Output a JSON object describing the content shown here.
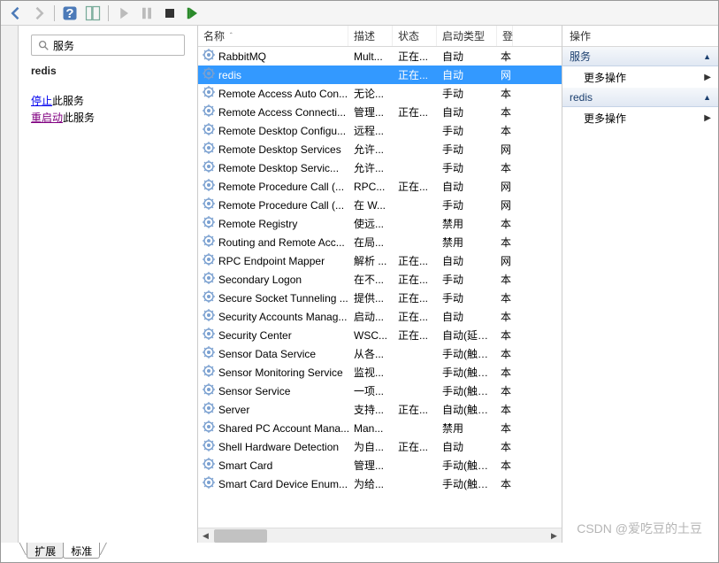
{
  "toolbar": {
    "back_icon": "back-icon",
    "forward_icon": "forward-icon",
    "help_icon": "help-icon",
    "details_icon": "details-icon",
    "play_icon": "play-icon",
    "pause_icon": "pause-icon",
    "stop_icon": "stop-icon",
    "restart_icon": "restart-icon"
  },
  "left": {
    "search_label": "服务",
    "selected_name": "redis",
    "stop_link": "停止",
    "stop_text": "此服务",
    "restart_link": "重启动",
    "restart_text": "此服务"
  },
  "grid": {
    "headers": {
      "name": "名称",
      "desc": "描述",
      "status": "状态",
      "start": "启动类型",
      "login": "登"
    },
    "rows": [
      {
        "name": "RabbitMQ",
        "desc": "Mult...",
        "status": "正在...",
        "start": "自动",
        "login": "本",
        "selected": false
      },
      {
        "name": "redis",
        "desc": "",
        "status": "正在...",
        "start": "自动",
        "login": "网",
        "selected": true
      },
      {
        "name": "Remote Access Auto Con...",
        "desc": "无论...",
        "status": "",
        "start": "手动",
        "login": "本",
        "selected": false
      },
      {
        "name": "Remote Access Connecti...",
        "desc": "管理...",
        "status": "正在...",
        "start": "自动",
        "login": "本",
        "selected": false
      },
      {
        "name": "Remote Desktop Configu...",
        "desc": "远程...",
        "status": "",
        "start": "手动",
        "login": "本",
        "selected": false
      },
      {
        "name": "Remote Desktop Services",
        "desc": "允许...",
        "status": "",
        "start": "手动",
        "login": "网",
        "selected": false
      },
      {
        "name": "Remote Desktop Servic...",
        "desc": "允许...",
        "status": "",
        "start": "手动",
        "login": "本",
        "selected": false
      },
      {
        "name": "Remote Procedure Call (...",
        "desc": "RPC...",
        "status": "正在...",
        "start": "自动",
        "login": "网",
        "selected": false
      },
      {
        "name": "Remote Procedure Call (...",
        "desc": "在 W...",
        "status": "",
        "start": "手动",
        "login": "网",
        "selected": false
      },
      {
        "name": "Remote Registry",
        "desc": "使远...",
        "status": "",
        "start": "禁用",
        "login": "本",
        "selected": false
      },
      {
        "name": "Routing and Remote Acc...",
        "desc": "在局...",
        "status": "",
        "start": "禁用",
        "login": "本",
        "selected": false
      },
      {
        "name": "RPC Endpoint Mapper",
        "desc": "解析 ...",
        "status": "正在...",
        "start": "自动",
        "login": "网",
        "selected": false
      },
      {
        "name": "Secondary Logon",
        "desc": "在不...",
        "status": "正在...",
        "start": "手动",
        "login": "本",
        "selected": false
      },
      {
        "name": "Secure Socket Tunneling ...",
        "desc": "提供...",
        "status": "正在...",
        "start": "手动",
        "login": "本",
        "selected": false
      },
      {
        "name": "Security Accounts Manag...",
        "desc": "启动...",
        "status": "正在...",
        "start": "自动",
        "login": "本",
        "selected": false
      },
      {
        "name": "Security Center",
        "desc": "WSC...",
        "status": "正在...",
        "start": "自动(延迟...",
        "login": "本",
        "selected": false
      },
      {
        "name": "Sensor Data Service",
        "desc": "从各...",
        "status": "",
        "start": "手动(触发...",
        "login": "本",
        "selected": false
      },
      {
        "name": "Sensor Monitoring Service",
        "desc": "监视...",
        "status": "",
        "start": "手动(触发...",
        "login": "本",
        "selected": false
      },
      {
        "name": "Sensor Service",
        "desc": "一项...",
        "status": "",
        "start": "手动(触发...",
        "login": "本",
        "selected": false
      },
      {
        "name": "Server",
        "desc": "支持...",
        "status": "正在...",
        "start": "自动(触发...",
        "login": "本",
        "selected": false
      },
      {
        "name": "Shared PC Account Mana...",
        "desc": "Man...",
        "status": "",
        "start": "禁用",
        "login": "本",
        "selected": false
      },
      {
        "name": "Shell Hardware Detection",
        "desc": "为自...",
        "status": "正在...",
        "start": "自动",
        "login": "本",
        "selected": false
      },
      {
        "name": "Smart Card",
        "desc": "管理...",
        "status": "",
        "start": "手动(触发...",
        "login": "本",
        "selected": false
      },
      {
        "name": "Smart Card Device Enum...",
        "desc": "为给...",
        "status": "",
        "start": "手动(触发...",
        "login": "本",
        "selected": false
      }
    ]
  },
  "actions": {
    "header": "操作",
    "group1": "服务",
    "group1_item": "更多操作",
    "group2": "redis",
    "group2_item": "更多操作"
  },
  "tabs": {
    "extended": "扩展",
    "standard": "标准"
  },
  "watermark": "CSDN @爱吃豆的土豆"
}
